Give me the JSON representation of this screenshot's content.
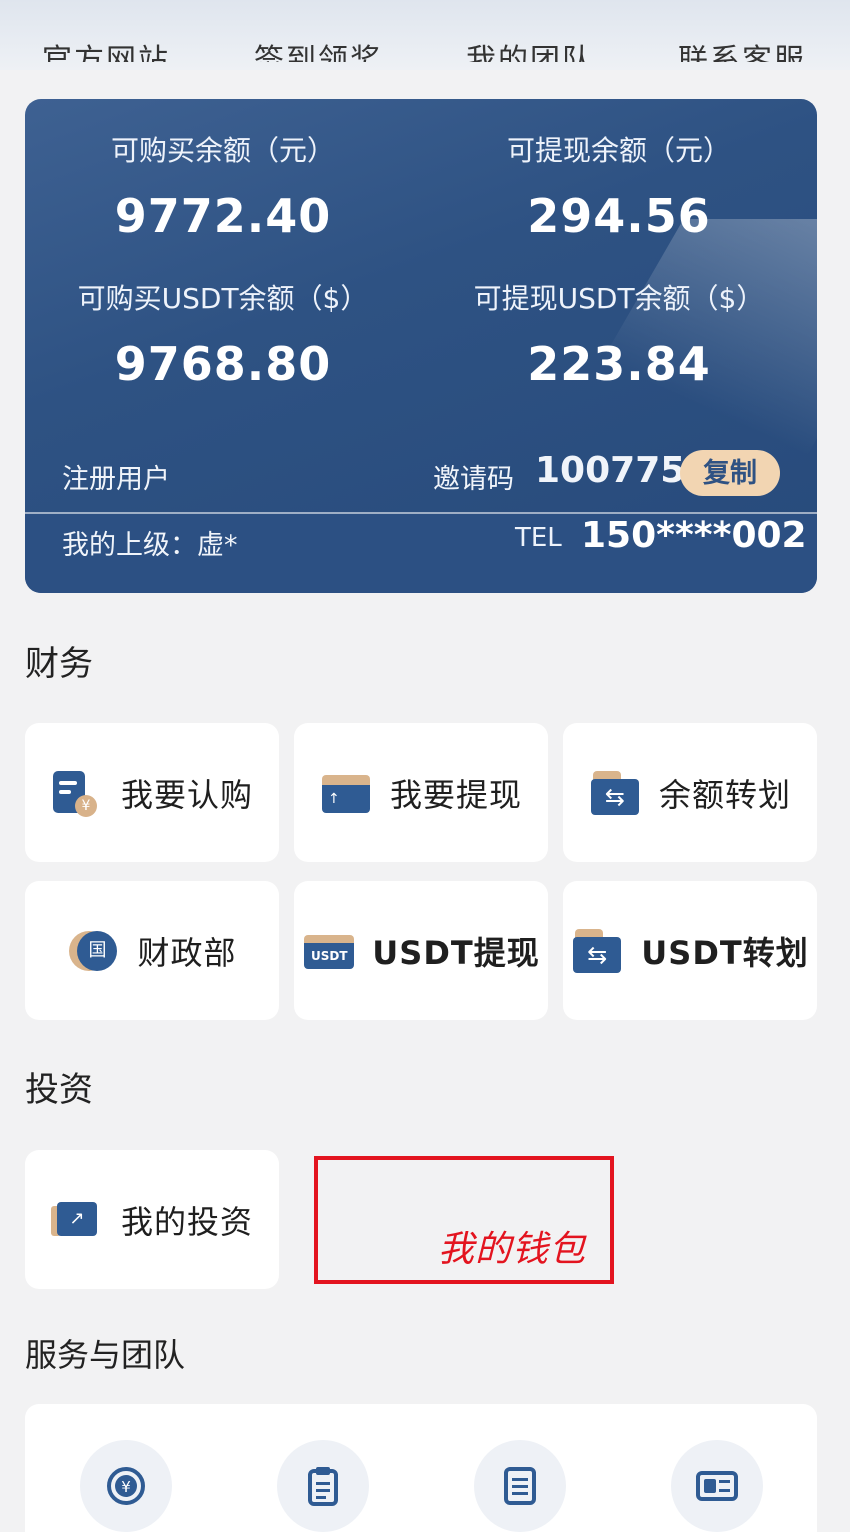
{
  "topnav": {
    "items": [
      "官方网站",
      "签到领奖",
      "我的团队",
      "联系客服"
    ]
  },
  "balance_card": {
    "purchasable_label": "可购买余额（元）",
    "purchasable_value": "9772.40",
    "withdrawable_label": "可提现余额（元）",
    "withdrawable_value": "294.56",
    "usdt_purchasable_label": "可购买USDT余额（$）",
    "usdt_purchasable_value": "9768.80",
    "usdt_withdrawable_label": "可提现USDT余额（$）",
    "usdt_withdrawable_value": "223.84",
    "user_type": "注册用户",
    "invite_label": "邀请码",
    "invite_code": "100775",
    "copy_label": "复制",
    "superior_label": "我的上级：虚*",
    "tel_label": "TEL",
    "tel_value": "150****002"
  },
  "finance": {
    "title": "财务",
    "tiles": [
      {
        "label": "我要认购",
        "icon": "subscribe-icon"
      },
      {
        "label": "我要提现",
        "icon": "withdraw-wallet-icon"
      },
      {
        "label": "余额转划",
        "icon": "transfer-folder-icon"
      },
      {
        "label": "财政部",
        "icon": "treasury-coin-icon"
      },
      {
        "label": "USDT提现",
        "icon": "usdt-wallet-icon"
      },
      {
        "label": "USDT转划",
        "icon": "usdt-transfer-icon"
      }
    ],
    "coin_glyph": "¥",
    "treasury_glyph": "国",
    "usdt_badge": "USDT"
  },
  "invest": {
    "title": "投资",
    "tiles": [
      {
        "label": "我的投资",
        "icon": "investment-chart-icon"
      }
    ],
    "annotation": "我的钱包"
  },
  "services": {
    "title": "服务与团队",
    "icons": [
      "yuan-cycle-icon",
      "clipboard-icon",
      "document-icon",
      "id-card-icon"
    ]
  },
  "colors": {
    "brand_blue": "#2f5b93",
    "accent_gold": "#d9b48c",
    "annotation_red": "#e3141f",
    "page_bg": "#f2f2f3"
  }
}
